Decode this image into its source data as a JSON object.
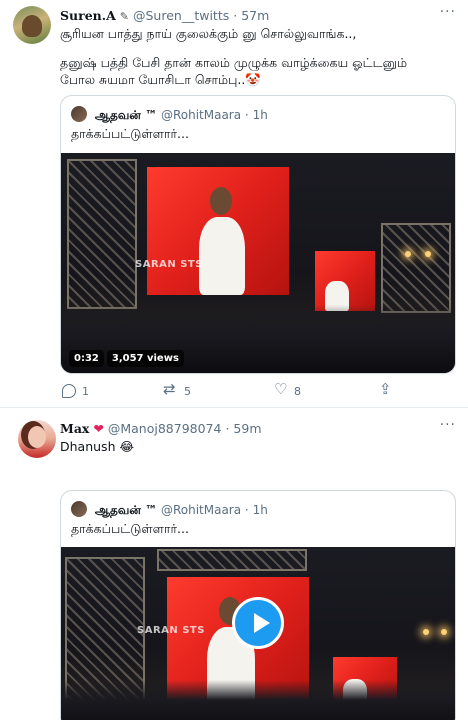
{
  "tweet1": {
    "name": "Suren.A",
    "handle": "@Suren__twitts",
    "time": "57m",
    "text_line1": "சூரியன பாத்து நாய் குலைக்கும் னு சொல்லுவாங்க..,",
    "text_line2": "தனுஷ் பத்தி பேசி தான் காலம் முழுக்க வாழ்க்கைய ஓட்டனும்",
    "text_line3": "போல சுயமா யோசிடா சொம்பு..🤡",
    "quote": {
      "name": "ஆதவன் ™",
      "handle": "@RohitMaara",
      "time": "1h",
      "text": "தாக்கப்பட்டுள்ளார்...",
      "video_time": "0:32",
      "video_views": "3,057 views",
      "watermark": "SARAN STS"
    },
    "actions": {
      "reply_count": "1",
      "retweet_count": "5",
      "like_count": "8"
    }
  },
  "tweet2": {
    "name": "Max",
    "handle": "@Manoj88798074",
    "time": "59m",
    "text": "Dhanush 😂",
    "quote": {
      "name": "ஆதவன் ™",
      "handle": "@RohitMaara",
      "time": "1h",
      "text": "தாக்கப்பட்டுள்ளார்...",
      "watermark": "SARAN STS"
    }
  },
  "colors": {
    "accent": "#1d9bf0",
    "secondary_text": "#5b7083",
    "heart": "#e0245e"
  },
  "icons": [
    "more-icon",
    "reply-icon",
    "retweet-icon",
    "like-icon",
    "share-icon",
    "play-icon",
    "heart-emoji-icon"
  ]
}
